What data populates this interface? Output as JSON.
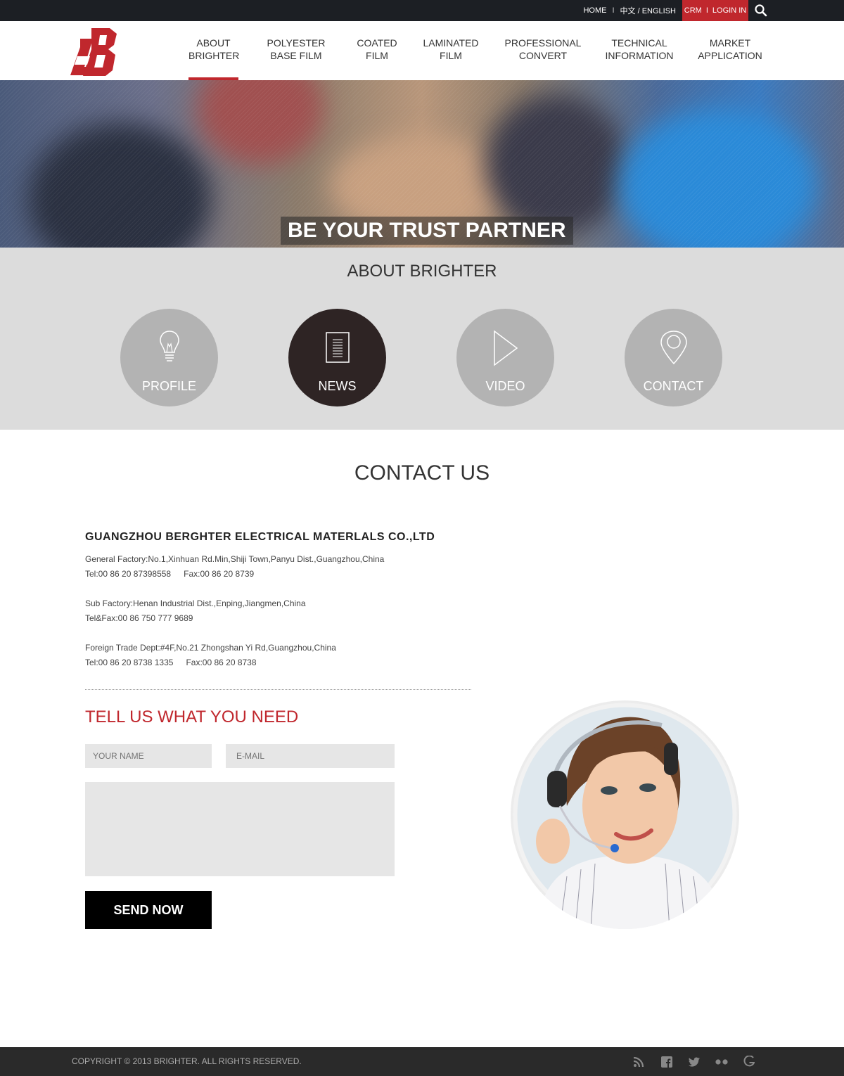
{
  "topbar": {
    "home": "HOME",
    "lang": "中文 / ENGLISH",
    "crm": "CRM",
    "login": "LOGIN IN",
    "search_icon": "search-icon"
  },
  "nav": {
    "items": [
      {
        "label": "ABOUT\nBRIGHTER"
      },
      {
        "label": "POLYESTER\nBASE FILM"
      },
      {
        "label": "COATED\nFILM"
      },
      {
        "label": "LAMINATED\nFILM"
      },
      {
        "label": "PROFESSIONAL\nCONVERT"
      },
      {
        "label": "TECHNICAL\nINFORMATION"
      },
      {
        "label": "MARKET\nAPPLICATION"
      }
    ]
  },
  "hero": {
    "tagline": "BE YOUR TRUST PARTNER"
  },
  "about": {
    "title": "ABOUT BRIGHTER",
    "items": [
      {
        "label": "PROFILE",
        "icon": "lightbulb-icon"
      },
      {
        "label": "NEWS",
        "icon": "document-icon"
      },
      {
        "label": "VIDEO",
        "icon": "play-icon"
      },
      {
        "label": "CONTACT",
        "icon": "location-pin-icon"
      }
    ]
  },
  "contact": {
    "title": "CONTACT US",
    "company": "GUANGZHOU BERGHTER ELECTRICAL MATERLALS CO.,LTD",
    "general_addr": "General Factory:No.1,Xinhuan Rd.Min,Shiji Town,Panyu Dist.,Guangzhou,China",
    "general_tel": "Tel:00 86 20 87398558",
    "general_fax": "Fax:00 86 20 8739",
    "sub_addr": "Sub Factory:Henan Industrial Dist.,Enping,Jiangmen,China",
    "sub_telfax": "Tel&Fax:00 86 750 777 9689",
    "foreign_addr": "Foreign Trade Dept:#4F,No.21 Zhongshan Yi Rd,Guangzhou,China",
    "foreign_tel": "Tel:00 86 20 8738 1335",
    "foreign_fax": "Fax:00 86 20 8738"
  },
  "form": {
    "title": "TELL US WHAT YOU NEED",
    "name_placeholder": "YOUR NAME",
    "email_placeholder": "E-MAIL",
    "send_label": "SEND NOW"
  },
  "footer": {
    "copyright": "COPYRIGHT © 2013 BRIGHTER. ALL RIGHTS RESERVED.",
    "social": [
      "rss-icon",
      "facebook-icon",
      "twitter-icon",
      "flickr-icon",
      "google-icon"
    ]
  },
  "colors": {
    "accent": "#c0272d",
    "dark": "#1c1f24",
    "gray_section": "#dcdcdc",
    "circle_active": "#2e2424",
    "circle": "#b3b3b3"
  }
}
